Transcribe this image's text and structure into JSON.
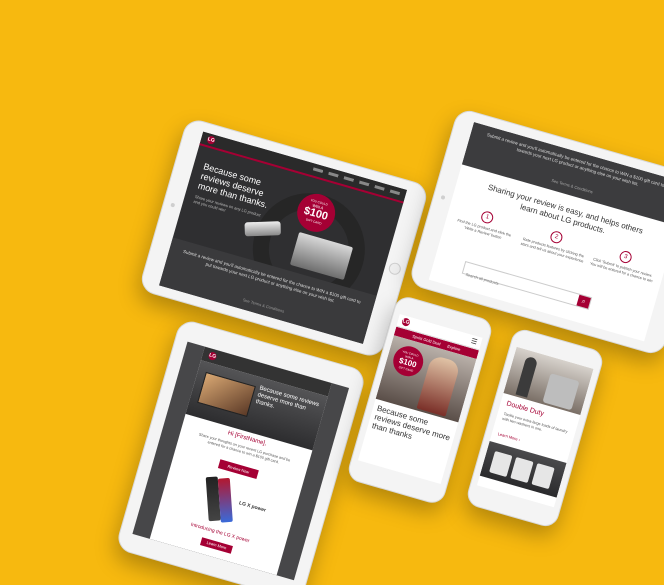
{
  "brand": {
    "logo_text": "LG",
    "accent": "#a50034",
    "background": "#f7b90f"
  },
  "tablet1": {
    "headline": "Because some reviews deserve more than thanks.",
    "sub": "Share your reviews on any LG product and you could win!",
    "badge": {
      "line1": "YOU COULD",
      "line2": "WIN A",
      "amount": "$100",
      "line3": "GIFT CARD"
    },
    "body": "Submit a review and you'll automatically be entered for the chance to WIN a $100 gift card to put towards your next LG product or anything else on your wish list.",
    "footer_link": "See Terms & Conditions"
  },
  "tablet2": {
    "top_text": "Submit a review and you'll automatically be entered for the chance to WIN a $100 gift card to put towards your next LG product or anything else on your wish list.",
    "link": "See Terms & Conditions",
    "heading": "Sharing your review is easy, and helps others learn about LG products.",
    "steps": [
      {
        "num": "1",
        "text": "Find the LG product and click the 'Write a Review' button"
      },
      {
        "num": "2",
        "text": "Rate products features by clicking the stars and tell us about your experience"
      },
      {
        "num": "3",
        "text": "Click 'Submit' to publish your review. You will be entered for a chance to win"
      }
    ],
    "search_placeholder": "Search all products"
  },
  "tablet3": {
    "headline": "Because some reviews deserve more than thanks.",
    "greeting": "Hi [FirstName],",
    "body": "Share your thoughts on your recent LG purchase and be entered for a chance to win a $100 gift card.",
    "button": "Review Now",
    "product": "LG X power",
    "bottom_heading": "Introducing the LG X power",
    "bottom_button": "Learn More"
  },
  "phone1": {
    "nav_left": "Sprint Gold Deal",
    "nav_right": "Explore",
    "badge": {
      "line1": "YOU COULD",
      "line2": "WIN A",
      "amount": "$100",
      "line3": "GIFT CARD"
    },
    "headline": "Because some reviews deserve more than thanks"
  },
  "phone2": {
    "title": "Double Duty",
    "body": "Tackle your extra-large loads of laundry with two washers in one.",
    "link": "Learn More"
  }
}
